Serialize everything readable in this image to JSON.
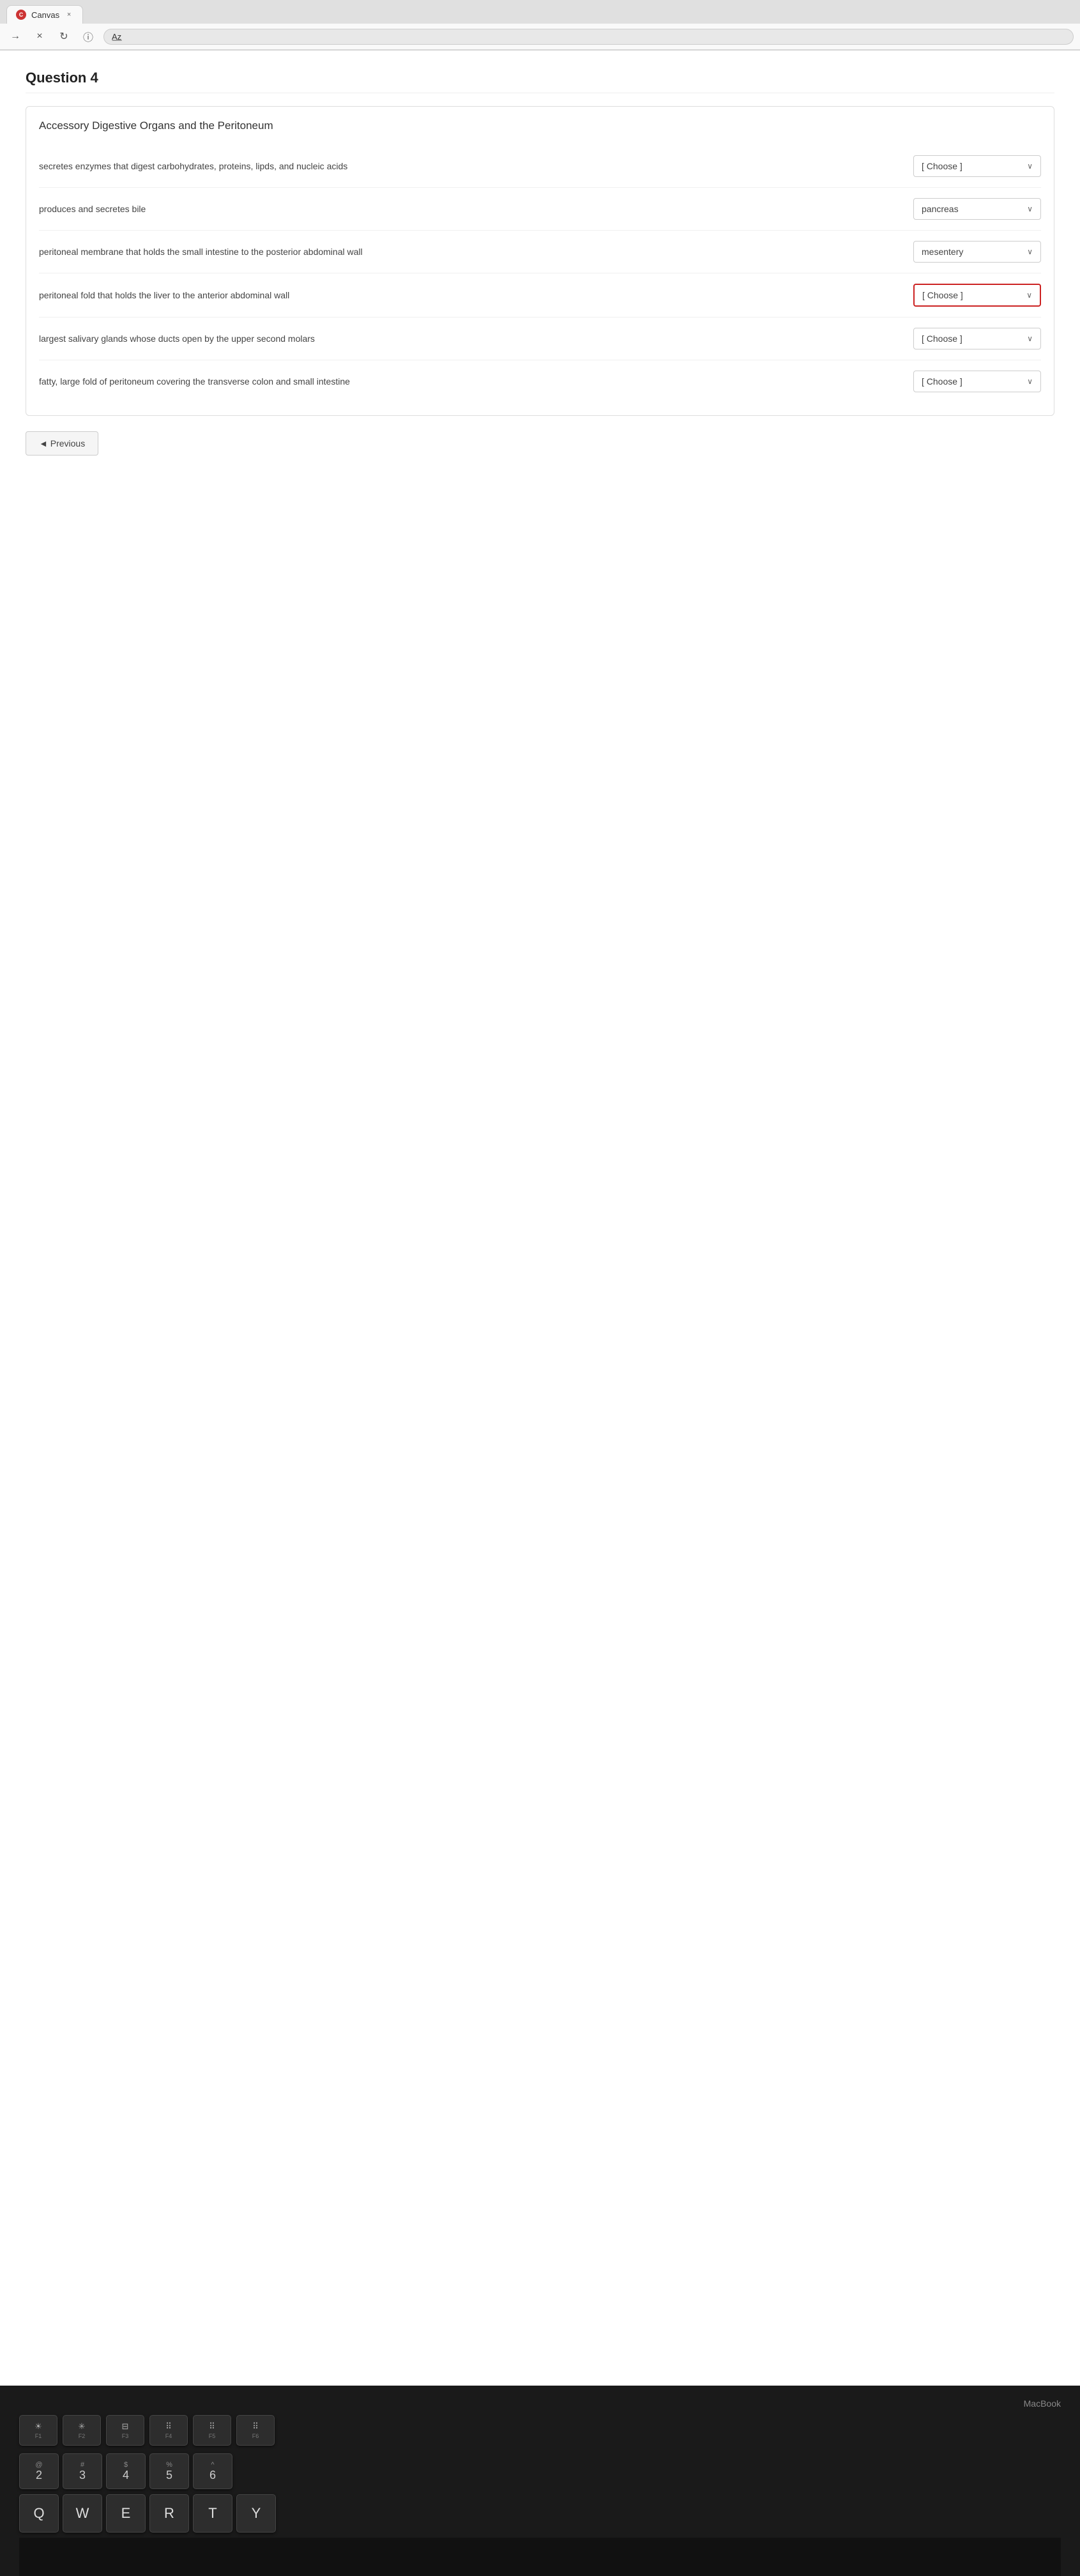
{
  "browser": {
    "tab_icon": "C",
    "tab_label": "Canvas",
    "tab_close": "×",
    "nav_back": "→",
    "nav_close": "×",
    "nav_refresh": "↻",
    "nav_info": "ⓘ",
    "nav_reader": "A̲z̲"
  },
  "page": {
    "question_number": "Question 4",
    "quiz_title": "Accessory Digestive Organs and the Peritoneum",
    "rows": [
      {
        "id": 1,
        "description": "secretes enzymes that digest carbohydrates, proteins, lipds, and nucleic acids",
        "select_value": "[ Choose ]",
        "highlighted": false
      },
      {
        "id": 2,
        "description": "produces and secretes bile",
        "select_value": "pancreas",
        "highlighted": false
      },
      {
        "id": 3,
        "description": "peritoneal membrane that holds the small intestine to the posterior abdominal wall",
        "select_value": "mesentery",
        "highlighted": false
      },
      {
        "id": 4,
        "description": "peritoneal fold that holds the liver to the anterior abdominal wall",
        "select_value": "[ Choose ]",
        "highlighted": true
      },
      {
        "id": 5,
        "description": "largest salivary glands whose ducts open by the upper second molars",
        "select_value": "[ Choose ]",
        "highlighted": false
      },
      {
        "id": 6,
        "description": "fatty, large fold of peritoneum covering the transverse colon and small intestine",
        "select_value": "[ Choose ]",
        "highlighted": false
      }
    ],
    "prev_button": "◄ Previous"
  },
  "keyboard": {
    "macbook_label": "MacBook",
    "fn_keys": [
      {
        "icon": "☀",
        "label": "F1"
      },
      {
        "icon": "✳",
        "label": "F2"
      },
      {
        "icon": "⊞",
        "label": "F3"
      },
      {
        "icon": "⣿",
        "label": "F4"
      },
      {
        "icon": "⠿",
        "label": "F5"
      },
      {
        "icon": "⠿",
        "label": "F6"
      }
    ],
    "number_keys": [
      {
        "sym": "@",
        "num": "2"
      },
      {
        "sym": "#",
        "num": "3"
      },
      {
        "sym": "$",
        "num": "4"
      },
      {
        "sym": "%",
        "num": "5"
      },
      {
        "sym": "^",
        "num": "6"
      }
    ],
    "letter_keys": [
      "Q",
      "W",
      "E",
      "R",
      "T",
      "Y"
    ]
  }
}
